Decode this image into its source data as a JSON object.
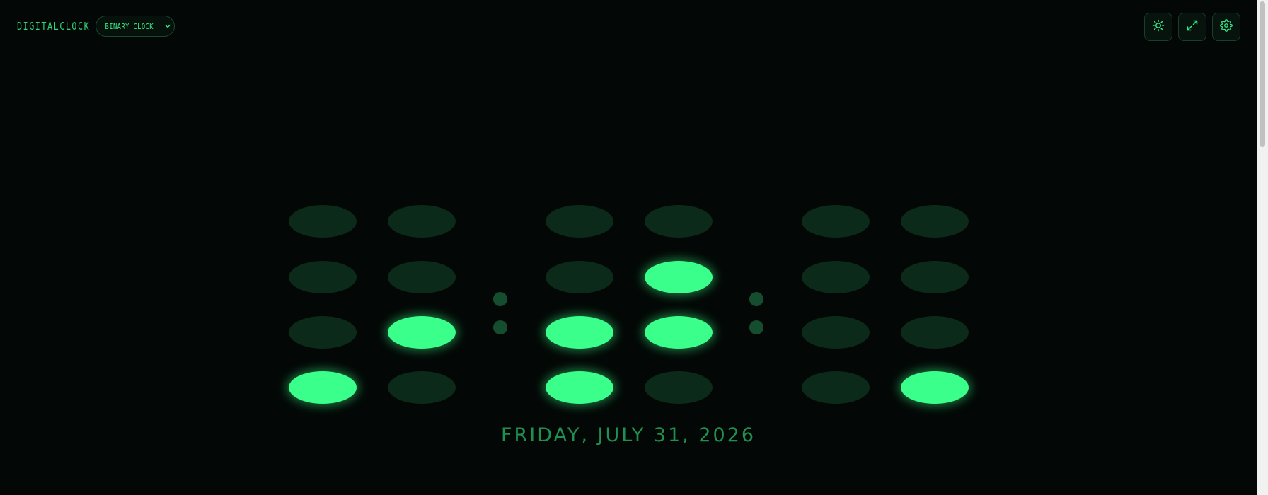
{
  "brand": {
    "name": "DIGITALCLOCK"
  },
  "mode_select": {
    "selected": "BINARY CLOCK",
    "icon": "chevron-down-icon"
  },
  "toolbar": {
    "buttons": [
      {
        "id": "theme",
        "icon": "sun-icon"
      },
      {
        "id": "fullscreen",
        "icon": "expand-icon"
      },
      {
        "id": "settings",
        "icon": "gear-icon"
      }
    ]
  },
  "clock": {
    "mode": "binary",
    "time": "12:36:01",
    "digits": [
      1,
      2,
      3,
      6,
      0,
      1
    ],
    "bit_weights": [
      8,
      4,
      2,
      1
    ],
    "colors": {
      "on": "#3aff8a",
      "off": "#0c2a1a",
      "separator": "#154d2f"
    }
  },
  "date": {
    "text": "FRIDAY, JULY 31, 2026",
    "color": "#1f9050"
  },
  "theme": {
    "background": "#030806",
    "accent": "#35e888"
  }
}
